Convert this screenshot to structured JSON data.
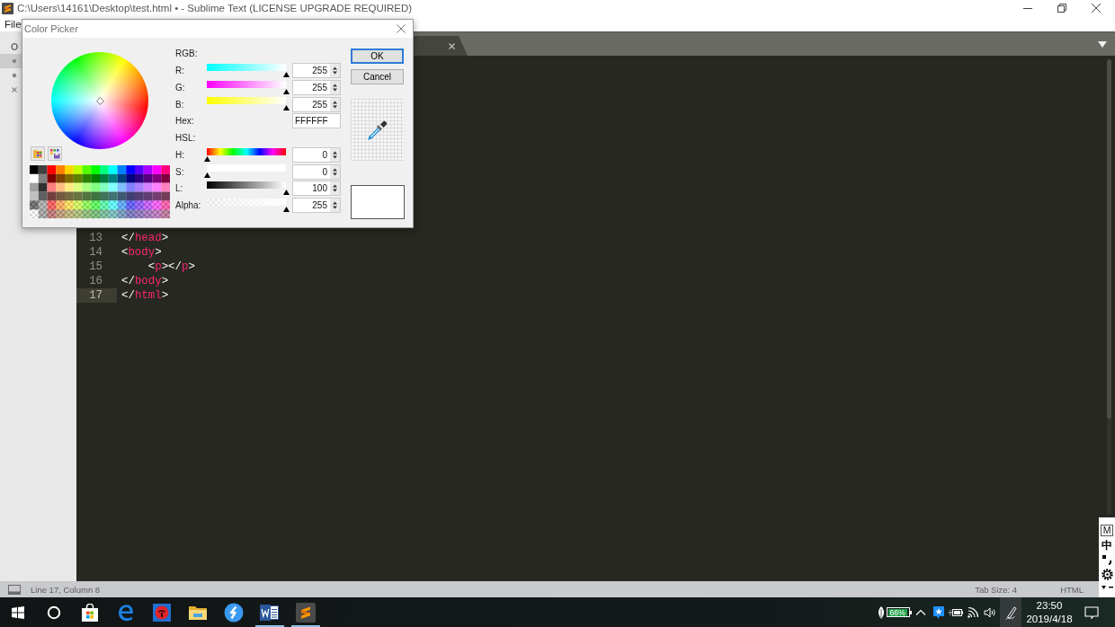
{
  "window": {
    "title": "C:\\Users\\14161\\Desktop\\test.html • - Sublime Text (LICENSE UPGRADE REQUIRED)"
  },
  "menu_bar": {
    "items": [
      "File"
    ]
  },
  "sidebar": {
    "heading": "O",
    "items": [
      {
        "kind": "dot",
        "selected": true
      },
      {
        "kind": "dot",
        "selected": false
      },
      {
        "kind": "close",
        "selected": false
      }
    ]
  },
  "tabs": [
    {
      "selected": true
    }
  ],
  "editor": {
    "lines": [
      {
        "number": "13",
        "code": "</head>",
        "current": false
      },
      {
        "number": "14",
        "code": "<body>",
        "current": false
      },
      {
        "number": "15",
        "code": "    <p></p>",
        "current": false
      },
      {
        "number": "16",
        "code": "</body>",
        "current": false
      },
      {
        "number": "17",
        "code": "</html>",
        "current": true
      }
    ]
  },
  "color_picker": {
    "title": "Color Picker",
    "rows": [
      {
        "kind": "heading",
        "label": "RGB:"
      },
      {
        "kind": "red",
        "label": "R:",
        "value": "255",
        "level": 1
      },
      {
        "kind": "green",
        "label": "G:",
        "value": "255",
        "level": 1
      },
      {
        "kind": "blue",
        "label": "B:",
        "value": "255",
        "level": 1
      },
      {
        "kind": "hex",
        "label": "Hex:",
        "value": "FFFFFF"
      },
      {
        "kind": "heading",
        "label": "HSL:"
      },
      {
        "kind": "hue",
        "label": "H:",
        "value": "0",
        "level": 0
      },
      {
        "kind": "saturation",
        "label": "S:",
        "value": "0",
        "level": 0
      },
      {
        "kind": "lightness",
        "label": "L:",
        "value": "100",
        "level": 1
      },
      {
        "kind": "alpha",
        "label": "Alpha:",
        "value": "255",
        "level": 1
      }
    ],
    "buttons": [
      {
        "label": "OK",
        "default": true
      },
      {
        "label": "Cancel",
        "default": false
      }
    ]
  },
  "status_bar": {
    "position": "Line 17, Column 8",
    "tab_size": "Tab Size: 4",
    "syntax": "HTML"
  },
  "ime_bar": {
    "mode": "M",
    "language": "中"
  },
  "taskbar": {
    "apps": [
      {
        "kind": "start",
        "running": false
      },
      {
        "kind": "search",
        "running": false
      },
      {
        "kind": "store",
        "running": false
      },
      {
        "kind": "browser",
        "running": false
      },
      {
        "kind": "music",
        "running": false
      },
      {
        "kind": "files",
        "running": false
      },
      {
        "kind": "sync",
        "running": false
      },
      {
        "kind": "word",
        "running": true
      },
      {
        "kind": "editor",
        "running": true
      }
    ],
    "battery": "66%",
    "time": "23:50",
    "date": "2019/4/18"
  }
}
